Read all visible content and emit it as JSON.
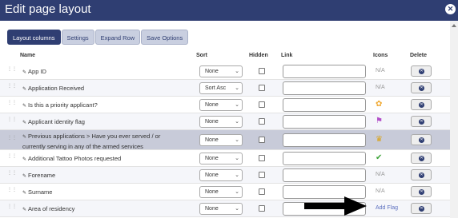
{
  "dialog": {
    "title": "Edit page layout",
    "close_icon": "close-icon"
  },
  "tabs": [
    {
      "label": "Layout columns",
      "active": true
    },
    {
      "label": "Settings",
      "active": false
    },
    {
      "label": "Expand Row",
      "active": false
    },
    {
      "label": "Save Options",
      "active": false
    }
  ],
  "columns": {
    "name": "Name",
    "sort": "Sort",
    "hidden": "Hidden",
    "link": "Link",
    "icons": "Icons",
    "delete": "Delete"
  },
  "rows": [
    {
      "name": "App ID",
      "sort": "None",
      "icons": "N/A"
    },
    {
      "name": "Application Received",
      "sort": "Sort Asc",
      "icons": "N/A"
    },
    {
      "name": "Is this a priority applicant?",
      "sort": "None",
      "icons": "flower-icon"
    },
    {
      "name": "Applicant identity flag",
      "sort": "None",
      "icons": "purple-flag-icon"
    },
    {
      "name_line1": "Previous applications > Have you ever served / or",
      "name_line2": "currently serving in any of the armed services",
      "sort": "None",
      "icons": "medal-icon"
    },
    {
      "name": "Additional Tattoo Photos requested",
      "sort": "None",
      "icons": "green-check-icon"
    },
    {
      "name": "Forename",
      "sort": "None",
      "icons": "N/A"
    },
    {
      "name": "Surname",
      "sort": "None",
      "icons": "N/A"
    },
    {
      "name": "Area of residency",
      "sort": "None",
      "icons": "Add Flag"
    }
  ],
  "colors": {
    "titlebar": "#2f3e72",
    "active_tab": "#2f3e72",
    "highlight_row": "#c8cbd9"
  }
}
